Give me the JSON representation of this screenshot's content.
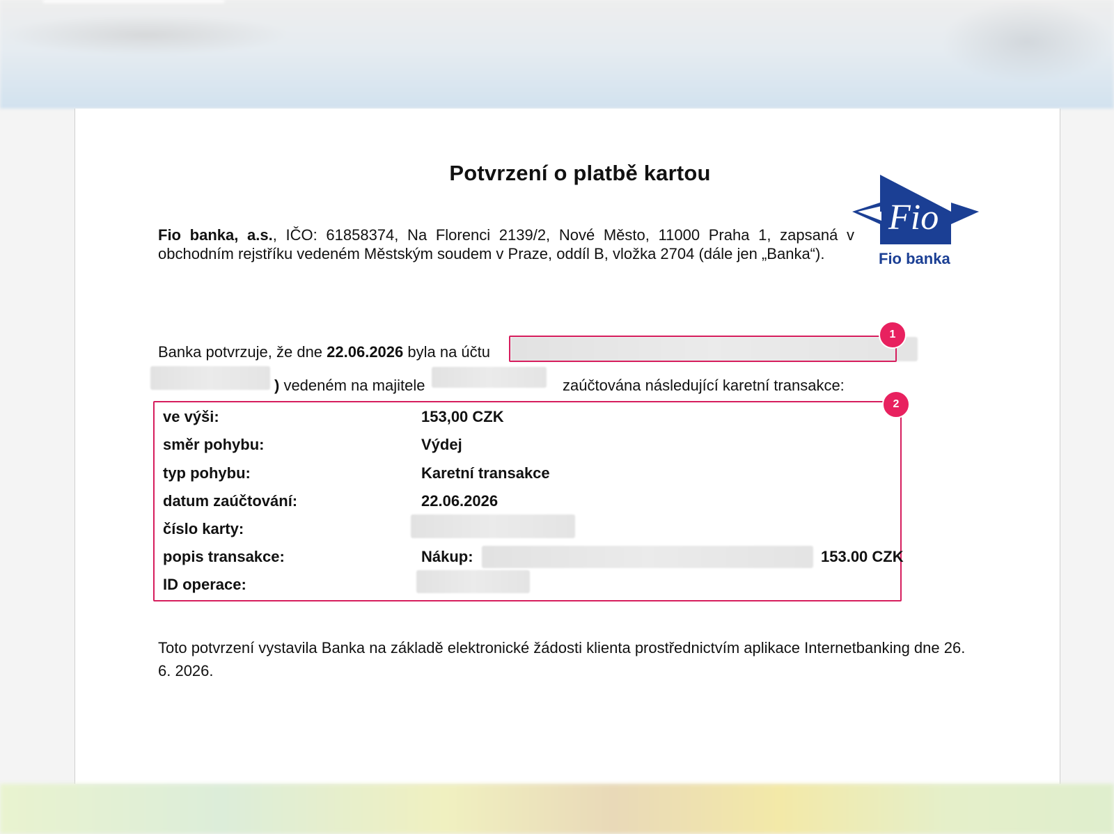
{
  "document": {
    "title": "Potvrzení o platbě kartou",
    "bank_name": "Fio banka, a.s.",
    "bank_info": ", IČO: 61858374, Na Florenci 2139/2, Nové Město, 11000 Praha 1, zapsaná v obchodním rejstříku vedeném Městským soudem v Praze, oddíl B, vložka 2704 (dále jen „Banka“).",
    "logo_text": "Fio",
    "logo_caption": "Fio banka",
    "confirm_prefix": "Banka potvrzuje, že dne ",
    "confirm_date": "22.06.2026",
    "confirm_mid": " byla na účtu",
    "confirm_paren": ")",
    "confirm_owner": " vedeném na majitele",
    "confirm_suffix": "zaúčtována následující karetní transakce:",
    "footer": "Toto potvrzení vystavila Banka na základě elektronické žádosti klienta prostřednictvím aplikace Internetbanking dne 26. 6. 2026."
  },
  "markers": {
    "m1": "1",
    "m2": "2"
  },
  "transaction": {
    "amount_label": "ve výši:",
    "amount_value": "153,00 CZK",
    "direction_label": "směr pohybu:",
    "direction_value": "Výdej",
    "type_label": "typ pohybu:",
    "type_value": "Karetní transakce",
    "date_label": "datum zaúčtování:",
    "date_value": "22.06.2026",
    "card_label": "číslo karty:",
    "desc_label": "popis transakce:",
    "desc_prefix": "Nákup:",
    "desc_amount": "153.00 CZK",
    "op_label": "ID operace:"
  },
  "colors": {
    "highlight": "#d61d5d",
    "marker": "#e8215f",
    "logo_blue": "#1b3f94"
  }
}
